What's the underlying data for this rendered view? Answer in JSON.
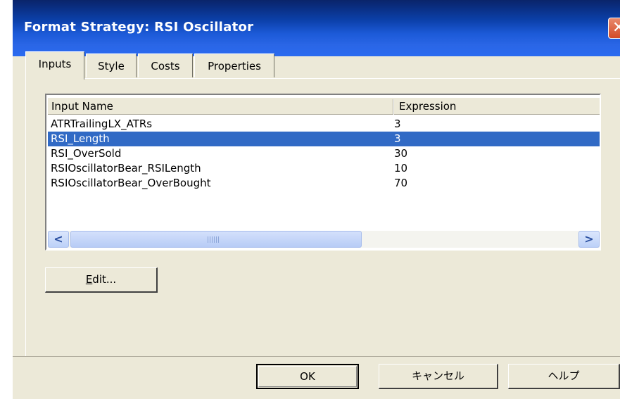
{
  "window": {
    "title": "Format Strategy: RSI Oscillator",
    "close_glyph": "✕"
  },
  "tabs": [
    {
      "label": "Inputs",
      "active": true
    },
    {
      "label": "Style",
      "active": false
    },
    {
      "label": "Costs",
      "active": false
    },
    {
      "label": "Properties",
      "active": false
    }
  ],
  "inputs_table": {
    "columns": [
      "Input Name",
      "Expression"
    ],
    "rows": [
      {
        "name": "ATRTrailingLX_ATRs",
        "expression": "3",
        "selected": false
      },
      {
        "name": "RSI_Length",
        "expression": "3",
        "selected": true
      },
      {
        "name": "RSI_OverSold",
        "expression": "30",
        "selected": false
      },
      {
        "name": "RSIOscillatorBear_RSILength",
        "expression": "10",
        "selected": false
      },
      {
        "name": "RSIOscillatorBear_OverBought",
        "expression": "70",
        "selected": false
      }
    ],
    "scroll_left_glyph": "<",
    "scroll_right_glyph": ">"
  },
  "buttons": {
    "edit_mnemonic": "E",
    "edit_rest": "dit...",
    "ok": "OK",
    "cancel": "キャンセル",
    "help": "ヘルプ"
  },
  "colors": {
    "selection": "#316ac5",
    "title_bar": "#0b3fa8",
    "dialog_bg": "#ece9d8"
  }
}
